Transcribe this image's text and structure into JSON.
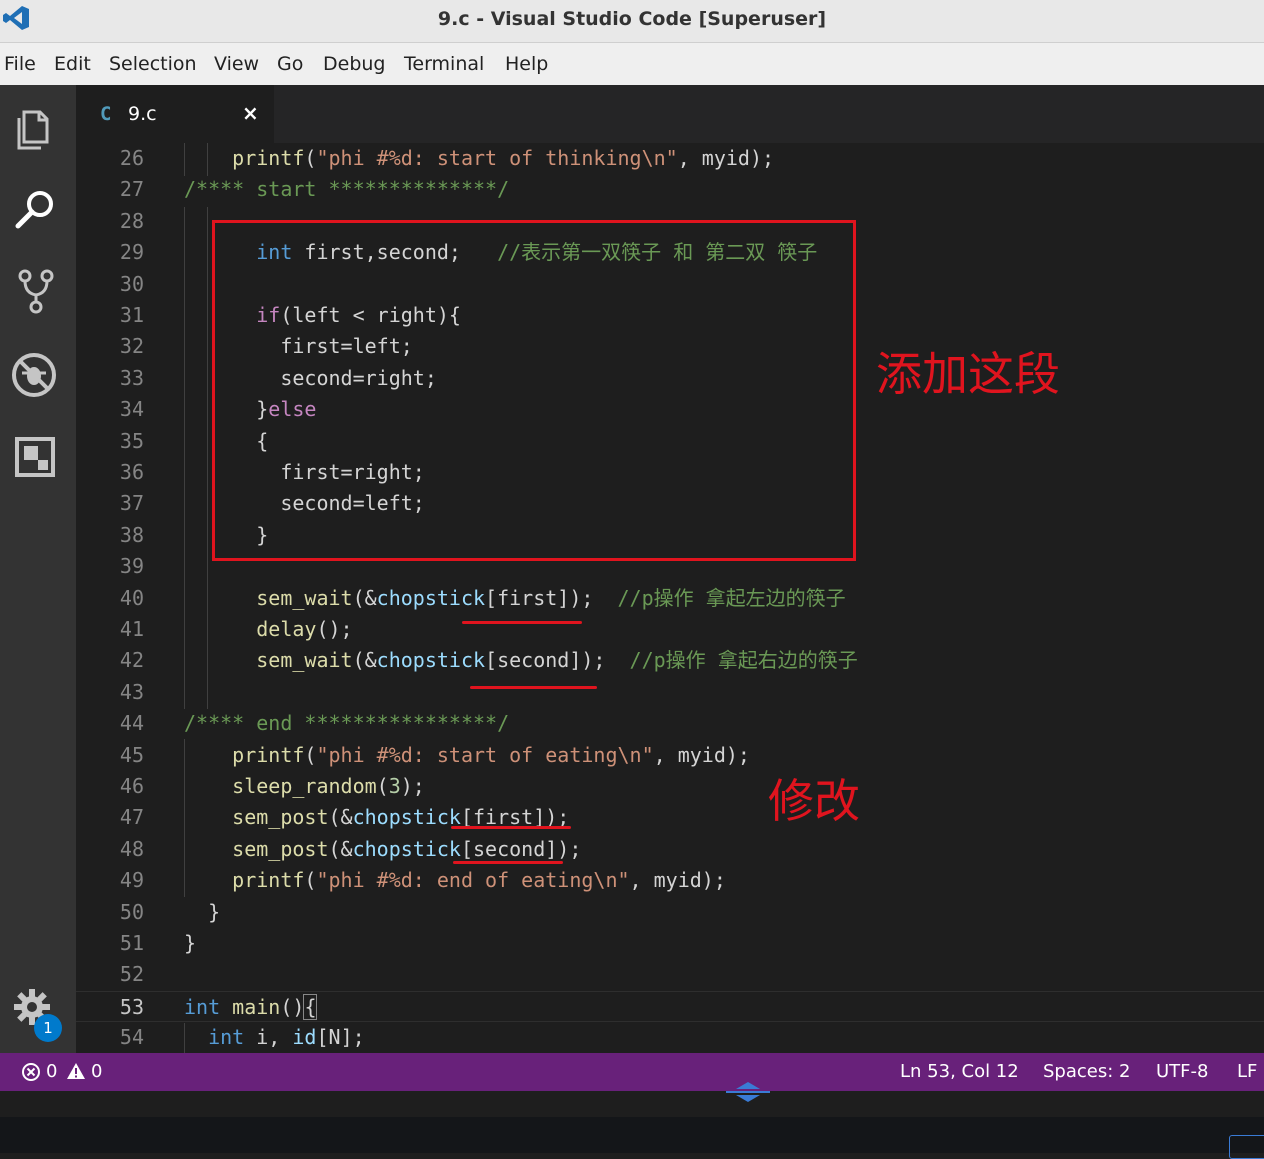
{
  "window": {
    "title": "9.c - Visual Studio Code [Superuser]"
  },
  "menu": [
    "File",
    "Edit",
    "Selection",
    "View",
    "Go",
    "Debug",
    "Terminal",
    "Help"
  ],
  "activity_bar": [
    "files-icon",
    "search-icon",
    "source-control-icon",
    "debug-icon",
    "extensions-icon"
  ],
  "settings": {
    "icon": "gear-icon",
    "badge": "1"
  },
  "tab": {
    "lang": "C",
    "name": "9.c",
    "close": "×"
  },
  "editor": {
    "lines": [
      {
        "n": "26",
        "html": "    <span class=\"fn\">printf</span>(<span class=\"str\">\"phi #%d: start of thinking\\n\"</span>, myid);"
      },
      {
        "n": "27",
        "html": "<span class=\"cm\">/**** start **************/</span>"
      },
      {
        "n": "28",
        "html": ""
      },
      {
        "n": "29",
        "html": "      <span class=\"kw\">int</span> first,second;   <span class=\"cm\">//表示第一双筷子 和 第二双 筷子</span>"
      },
      {
        "n": "30",
        "html": ""
      },
      {
        "n": "31",
        "html": "      <span class=\"ctl\">if</span>(left &lt; right){"
      },
      {
        "n": "32",
        "html": "        first=left;"
      },
      {
        "n": "33",
        "html": "        second=right;"
      },
      {
        "n": "34",
        "html": "      }<span class=\"ctl\">else</span>"
      },
      {
        "n": "35",
        "html": "      {"
      },
      {
        "n": "36",
        "html": "        first=right;"
      },
      {
        "n": "37",
        "html": "        second=left;"
      },
      {
        "n": "38",
        "html": "      }"
      },
      {
        "n": "39",
        "html": ""
      },
      {
        "n": "40",
        "html": "      <span class=\"fn\">sem_wait</span>(&amp;<span class=\"var\">chopstick</span>[first]);  <span class=\"cm\">//p操作 拿起左边的筷子</span>"
      },
      {
        "n": "41",
        "html": "      <span class=\"fn\">delay</span>();"
      },
      {
        "n": "42",
        "html": "      <span class=\"fn\">sem_wait</span>(&amp;<span class=\"var\">chopstick</span>[second]);  <span class=\"cm\">//p操作 拿起右边的筷子</span>"
      },
      {
        "n": "43",
        "html": ""
      },
      {
        "n": "44",
        "html": "<span class=\"cm\">/**** end ****************/</span>"
      },
      {
        "n": "45",
        "html": "    <span class=\"fn\">printf</span>(<span class=\"str\">\"phi #%d: start of eating\\n\"</span>, myid);"
      },
      {
        "n": "46",
        "html": "    <span class=\"fn\">sleep_random</span>(<span class=\"num\">3</span>);"
      },
      {
        "n": "47",
        "html": "    <span class=\"fn\">sem_post</span>(&amp;<span class=\"var\">chopstick</span>[first]);"
      },
      {
        "n": "48",
        "html": "    <span class=\"fn\">sem_post</span>(&amp;<span class=\"var\">chopstick</span>[second]);"
      },
      {
        "n": "49",
        "html": "    <span class=\"fn\">printf</span>(<span class=\"str\">\"phi #%d: end of eating\\n\"</span>, myid);"
      },
      {
        "n": "50",
        "html": "  }"
      },
      {
        "n": "51",
        "html": "}"
      },
      {
        "n": "52",
        "html": ""
      },
      {
        "n": "53",
        "html": "<span class=\"kw\">int</span> <span class=\"fn\">main</span>()<span class=\"bracket-box\">{</span>"
      },
      {
        "n": "54",
        "html": "  <span class=\"kw\">int</span> i, <span class=\"var\">id</span>[N];"
      }
    ],
    "current_line": "53"
  },
  "annotations": {
    "add_block": "添加这段",
    "modify": "修改"
  },
  "status": {
    "errors": "0",
    "warnings": "0",
    "position": "Ln 53, Col 12",
    "spaces": "Spaces: 2",
    "encoding": "UTF-8",
    "eol": "LF"
  },
  "colors": {
    "status_bar": "#68217a",
    "annotation": "#e0141e",
    "accent": "#007acc"
  }
}
